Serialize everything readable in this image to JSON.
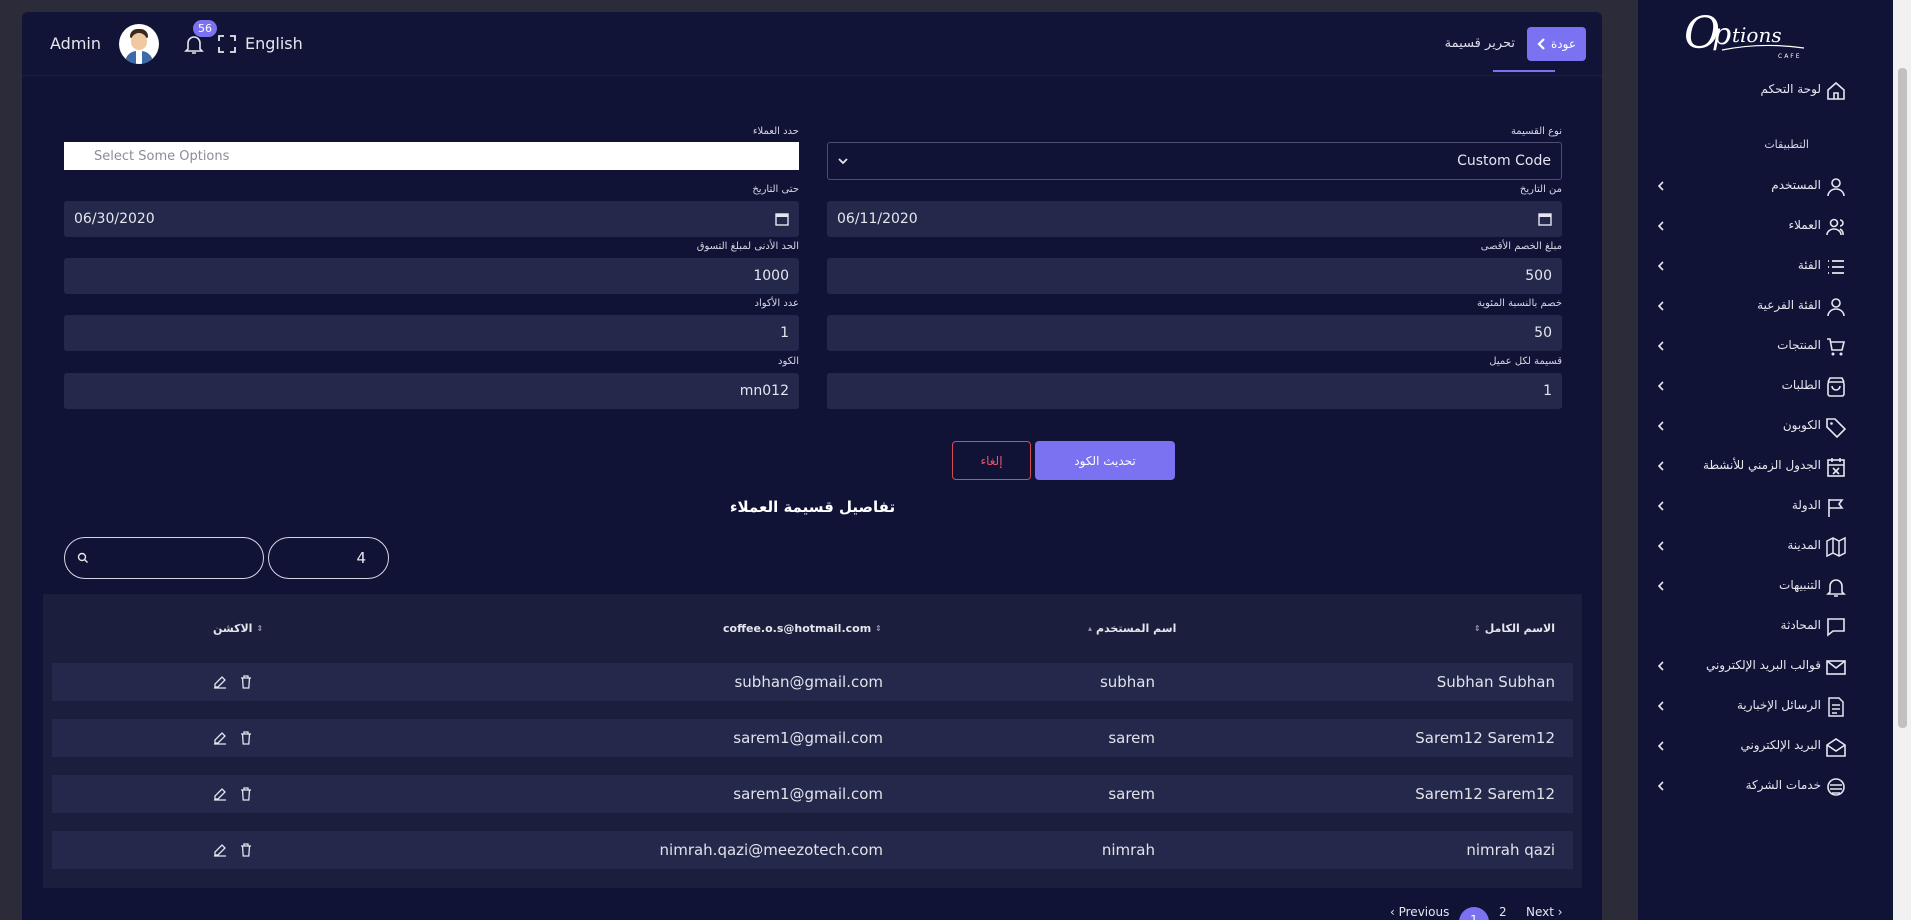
{
  "header": {
    "admin_name": "Admin",
    "notification_count": "56",
    "language": "English",
    "page_title": "تحرير قسيمة",
    "back_label": "عودة"
  },
  "form": {
    "coupon_type": {
      "label": "نوع القسيمة",
      "value": "Custom Code"
    },
    "customers": {
      "label": "حدد العملاء",
      "placeholder": "Select Some Options"
    },
    "from_date": {
      "label": "من التاريخ",
      "value": "06/11/2020"
    },
    "to_date": {
      "label": "حتى التاريخ",
      "value": "06/30/2020"
    },
    "max_discount": {
      "label": "مبلغ الخصم الأقصى",
      "value": "500"
    },
    "min_order": {
      "label": "الحد الأدنى لمبلغ التسوق",
      "value": "1000"
    },
    "percent_discount": {
      "label": "خصم بالنسبة المئوية",
      "value": "50"
    },
    "codes_count": {
      "label": "عدد الأكواد",
      "value": "1"
    },
    "per_customer": {
      "label": "قسيمة لكل عميل",
      "value": "1"
    },
    "code": {
      "label": "الكود",
      "value": "mn012"
    },
    "update_label": "تحديث الكود",
    "cancel_label": "إلغاء"
  },
  "details": {
    "title": "تفاصيل قسيمة العملاء",
    "page_size": "4",
    "search_placeholder": "",
    "columns": [
      "الاسم الكامل",
      "اسم المستخدم",
      "coffee.o.s@hotmail.com",
      "الاكشن"
    ],
    "rows": [
      {
        "full_name": "Subhan Subhan",
        "username": "subhan",
        "email": "subhan@gmail.com"
      },
      {
        "full_name": "Sarem12 Sarem12",
        "username": "sarem",
        "email": "sarem1@gmail.com"
      },
      {
        "full_name": "Sarem12 Sarem12",
        "username": "sarem",
        "email": "sarem1@gmail.com"
      },
      {
        "full_name": "nimrah qazi",
        "username": "nimrah",
        "email": "nimrah.qazi@meezotech.com"
      }
    ],
    "pager": {
      "previous": "‹ Previous",
      "page1": "1",
      "page2": "2",
      "next": "Next ›"
    }
  },
  "sidebar": {
    "brand": "Options",
    "brand_sub": "CAFE",
    "dashboard": "لوحة التحكم",
    "apps_section": "التطبيقات",
    "items": [
      {
        "label": "المستخدم",
        "icon": "user-icon",
        "chevron": true
      },
      {
        "label": "العملاء",
        "icon": "users-icon",
        "chevron": true
      },
      {
        "label": "الفئة",
        "icon": "list-icon",
        "chevron": true
      },
      {
        "label": "الفئة الفرعية",
        "icon": "user-icon",
        "chevron": true
      },
      {
        "label": "المنتجات",
        "icon": "cart-icon",
        "chevron": true
      },
      {
        "label": "الطلبات",
        "icon": "bag-icon",
        "chevron": true
      },
      {
        "label": "الكوبون",
        "icon": "tag-icon",
        "chevron": true
      },
      {
        "label": "الجدول الزمني للأنشطة",
        "icon": "calendar-x-icon",
        "chevron": true
      },
      {
        "label": "الدولة",
        "icon": "flag-icon",
        "chevron": true
      },
      {
        "label": "المدينة",
        "icon": "map-icon",
        "chevron": true
      },
      {
        "label": "التنبيهات",
        "icon": "bell-icon",
        "chevron": true
      },
      {
        "label": "المحادثة",
        "icon": "chat-icon",
        "chevron": false
      },
      {
        "label": "قوالب البريد الإلكتروني",
        "icon": "mail-icon",
        "chevron": true
      },
      {
        "label": "الرسائل الإخبارية",
        "icon": "file-icon",
        "chevron": true
      },
      {
        "label": "البريد الإلكتروني",
        "icon": "mail-open-icon",
        "chevron": true
      },
      {
        "label": "خدمات الشركة",
        "icon": "service-icon",
        "chevron": true
      }
    ]
  },
  "colors": {
    "accent": "#7a72f0",
    "bg": "#101336",
    "input_bg": "#24284a",
    "cancel": "#d64a55"
  }
}
